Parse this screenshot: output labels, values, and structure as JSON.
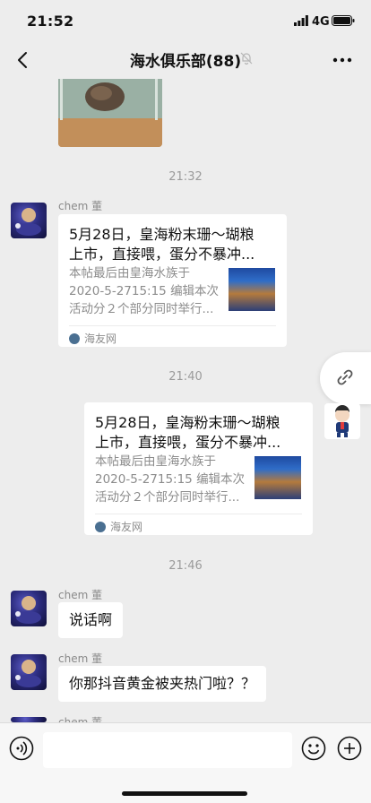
{
  "status_bar": {
    "time": "21:52",
    "network": "4G"
  },
  "nav": {
    "title": "海水俱乐部(88)"
  },
  "messages": {
    "ts1": "21:32",
    "card1": {
      "sender": "chem 董",
      "title_line1": "5月28日，皇海粉末珊～瑚粮",
      "title_line2": "上市，直接喂，蛋分不暴冲...",
      "desc_line1": "本帖最后由皇海水族于",
      "desc_line2": "2020-5-2715:15 编辑本次",
      "desc_line3": "活动分２个部分同时举行...",
      "source": "海友网"
    },
    "ts2": "21:40",
    "card2": {
      "title_line1": "5月28日，皇海粉末珊～瑚粮",
      "title_line2": "上市，直接喂，蛋分不暴冲...",
      "desc_line1": "本帖最后由皇海水族于",
      "desc_line2": "2020-5-2715:15 编辑本次",
      "desc_line3": "活动分２个部分同时举行...",
      "source": "海友网"
    },
    "ts3": "21:46",
    "msg1": {
      "sender": "chem 董",
      "text": "说话啊"
    },
    "msg2": {
      "sender": "chem 董",
      "text": "你那抖音黄金被夹热门啦？？"
    },
    "msg3": {
      "sender": "chem 董"
    }
  },
  "icons": {
    "back": "chevron-left-icon",
    "mute": "bell-off-icon",
    "more": "more-dots-icon",
    "link": "link-icon",
    "voice": "voice-icon",
    "emoji": "emoji-icon",
    "plus": "plus-icon"
  },
  "colors": {
    "background": "#EDEDED",
    "bubble": "#FFFFFF",
    "timestamp": "#9B9B9B"
  }
}
